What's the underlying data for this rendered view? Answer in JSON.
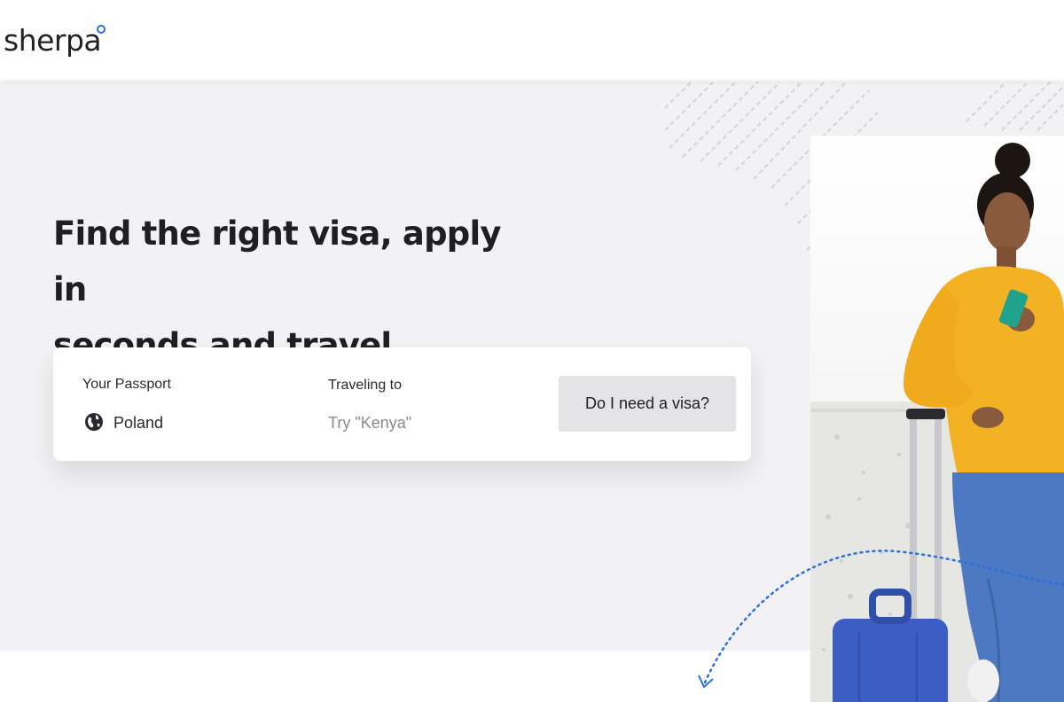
{
  "header": {
    "logo_text": "sherpa"
  },
  "hero": {
    "headline_line1": "Find the right visa, apply in",
    "headline_line2": "seconds and travel safely."
  },
  "search": {
    "passport_label": "Your Passport",
    "passport_value": "Poland",
    "passport_icon": "globe-icon",
    "destination_label": "Traveling to",
    "destination_placeholder": "Try \"Kenya\"",
    "cta_label": "Do I need a visa?"
  },
  "colors": {
    "accent": "#2b6fe0",
    "hero_bg": "#f2f2f4",
    "button_bg": "#e4e4e6",
    "sweater": "#f2b224",
    "suitcase": "#3a5ec4"
  }
}
